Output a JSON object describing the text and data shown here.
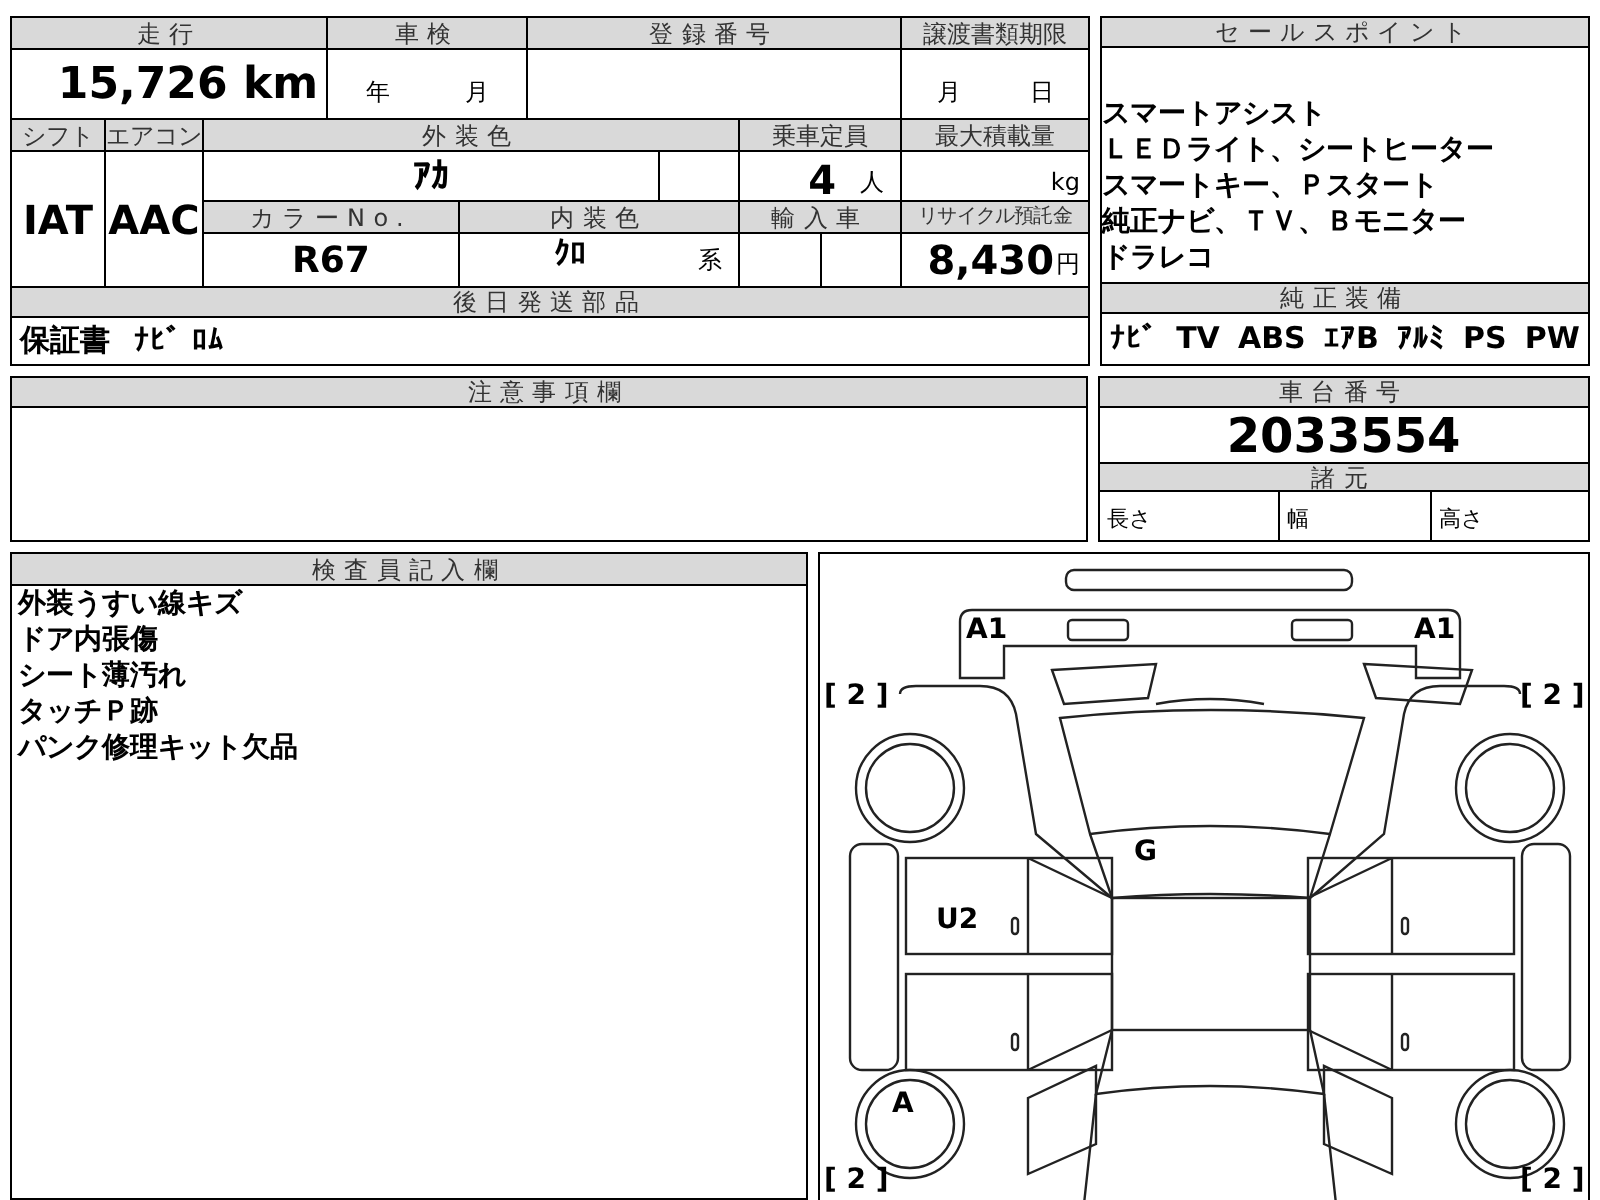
{
  "vehicle_table": {
    "mileage": {
      "label": "走行",
      "value": "15,726 km"
    },
    "inspection": {
      "label": "車検",
      "year_unit": "年",
      "month_unit": "月"
    },
    "registration_number": {
      "label": "登録番号"
    },
    "transfer_deadline": {
      "label": "譲渡書類期限",
      "month_unit": "月",
      "day_unit": "日"
    },
    "shift": {
      "label": "シフト",
      "value": "IAT"
    },
    "air_conditioner": {
      "label": "エアコン",
      "value": "AAC"
    },
    "exterior_color": {
      "label": "外装色",
      "value": "ｱｶ"
    },
    "capacity": {
      "label": "乗車定員",
      "value": "4",
      "unit": "人"
    },
    "max_load": {
      "label": "最大積載量",
      "unit": "kg"
    },
    "color_number": {
      "label": "カラーNo.",
      "value": "R67"
    },
    "interior_color": {
      "label": "内装色",
      "value": "ｸﾛ",
      "suffix": "系"
    },
    "imported": {
      "label": "輸入車"
    },
    "recycling_fee": {
      "label": "リサイクル預託金",
      "value": "8,430",
      "unit": "円"
    }
  },
  "sales_points": {
    "label": "セールスポイント",
    "lines": [
      "スマートアシスト",
      "ＬＥＤライト、シートヒーター",
      "スマートキー、Ｐスタート",
      "純正ナビ、ＴＶ、Ｂモニター",
      "ドラレコ"
    ]
  },
  "genuine_equipment": {
    "label": "純正装備",
    "items": [
      "ﾅﾋﾞ",
      "TV",
      "ABS",
      "ｴｱB",
      "ｱﾙﾐ",
      "PS",
      "PW"
    ]
  },
  "parts_sent_later": {
    "label": "後日発送部品",
    "items": [
      "保証書",
      "ﾅﾋﾞ ﾛﾑ"
    ]
  },
  "notes": {
    "label": "注意事項欄"
  },
  "chassis_number": {
    "label": "車台番号",
    "value": "2033554"
  },
  "specifications": {
    "label": "諸元",
    "items": [
      "長さ",
      "幅",
      "高さ"
    ]
  },
  "inspector_notes": {
    "label": "検査員記入欄",
    "lines": [
      "外装うすい線キズ",
      "ドア内張傷",
      "シート薄汚れ",
      "タッチＰ跡",
      "パンク修理キット欠品"
    ]
  },
  "damage_marks": [
    {
      "code": "A1"
    },
    {
      "code": "A1"
    },
    {
      "code": "[ 2 ]"
    },
    {
      "code": "[ 2 ]"
    },
    {
      "code": "G"
    },
    {
      "code": "U2"
    },
    {
      "code": "A"
    },
    {
      "code": "[ 2 ]"
    },
    {
      "code": "[ 2 ]"
    }
  ]
}
